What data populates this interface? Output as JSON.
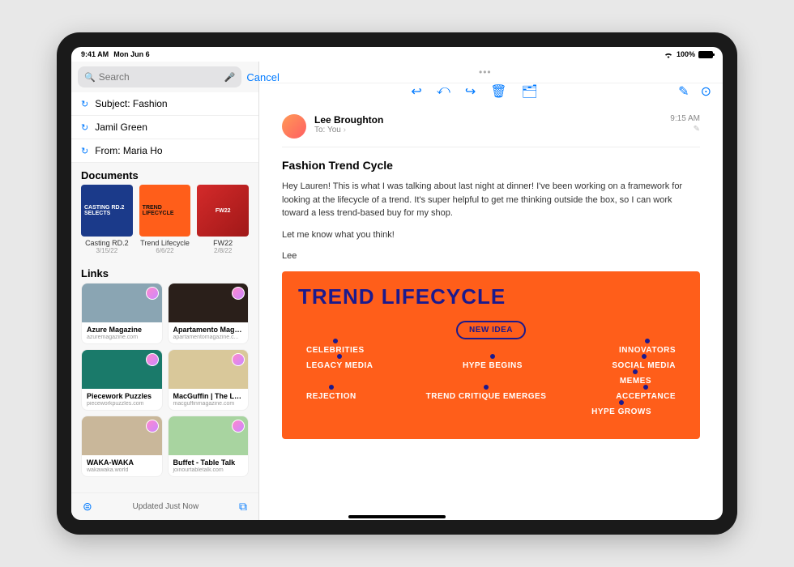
{
  "status_bar": {
    "time": "9:41 AM",
    "date": "Mon Jun 6",
    "battery": "100%"
  },
  "sidebar": {
    "search": {
      "placeholder": "Search",
      "value": ""
    },
    "cancel": "Cancel",
    "suggestions": [
      {
        "text": "Subject: Fashion"
      },
      {
        "text": "Jamil Green"
      },
      {
        "text": "From: Maria Ho"
      }
    ],
    "documents": {
      "title": "Documents",
      "items": [
        {
          "label": "Casting RD.2",
          "date": "3/15/22",
          "thumb_text": "CASTING RD.2 SELECTS"
        },
        {
          "label": "Trend Lifecycle",
          "date": "6/6/22",
          "thumb_text": "TREND LIFECYCLE"
        },
        {
          "label": "FW22",
          "date": "2/8/22",
          "thumb_text": "FW22"
        }
      ]
    },
    "links": {
      "title": "Links",
      "items": [
        {
          "label": "Azure Magazine",
          "domain": "azuremagazine.com"
        },
        {
          "label": "Apartamento Maga...",
          "domain": "apartamentomagazine.c..."
        },
        {
          "label": "Piecework Puzzles",
          "domain": "pieceworkpuzzles.com"
        },
        {
          "label": "MacGuffin | The Lif...",
          "domain": "macguffinmagazine.com"
        },
        {
          "label": "WAKA-WAKA",
          "domain": "wakawaka.world"
        },
        {
          "label": "Buffet - Table Talk",
          "domain": "joinourtabletalk.com"
        }
      ]
    },
    "footer_status": "Updated Just Now"
  },
  "email": {
    "sender": "Lee Broughton",
    "to_label": "To:",
    "recipient": "You",
    "time": "9:15 AM",
    "subject": "Fashion Trend Cycle",
    "body_p1": "Hey Lauren! This is what I was talking about last night at dinner! I've been working on a framework for looking at the lifecycle of a trend. It's super helpful to get me thinking outside the box, so I can work toward a less trend-based buy for my shop.",
    "body_p2": "Let me know what you think!",
    "body_p3": "Lee"
  },
  "attachment": {
    "title": "TREND LIFECYCLE",
    "nodes": {
      "new_idea": "NEW IDEA",
      "celebrities": "CELEBRITIES",
      "innovators": "INNOVATORS",
      "legacy_media": "LEGACY MEDIA",
      "hype_begins": "HYPE BEGINS",
      "social_media": "SOCIAL MEDIA",
      "memes": "MEMES",
      "rejection": "REJECTION",
      "trend_critique": "TREND CRITIQUE EMERGES",
      "acceptance": "ACCEPTANCE",
      "hype_grows": "HYPE GROWS"
    }
  },
  "link_thumb_colors": [
    "#8aa5b3",
    "#2a1f1a",
    "#1a7a6a",
    "#d9c89a",
    "#c9b79a",
    "#a8d4a0"
  ]
}
